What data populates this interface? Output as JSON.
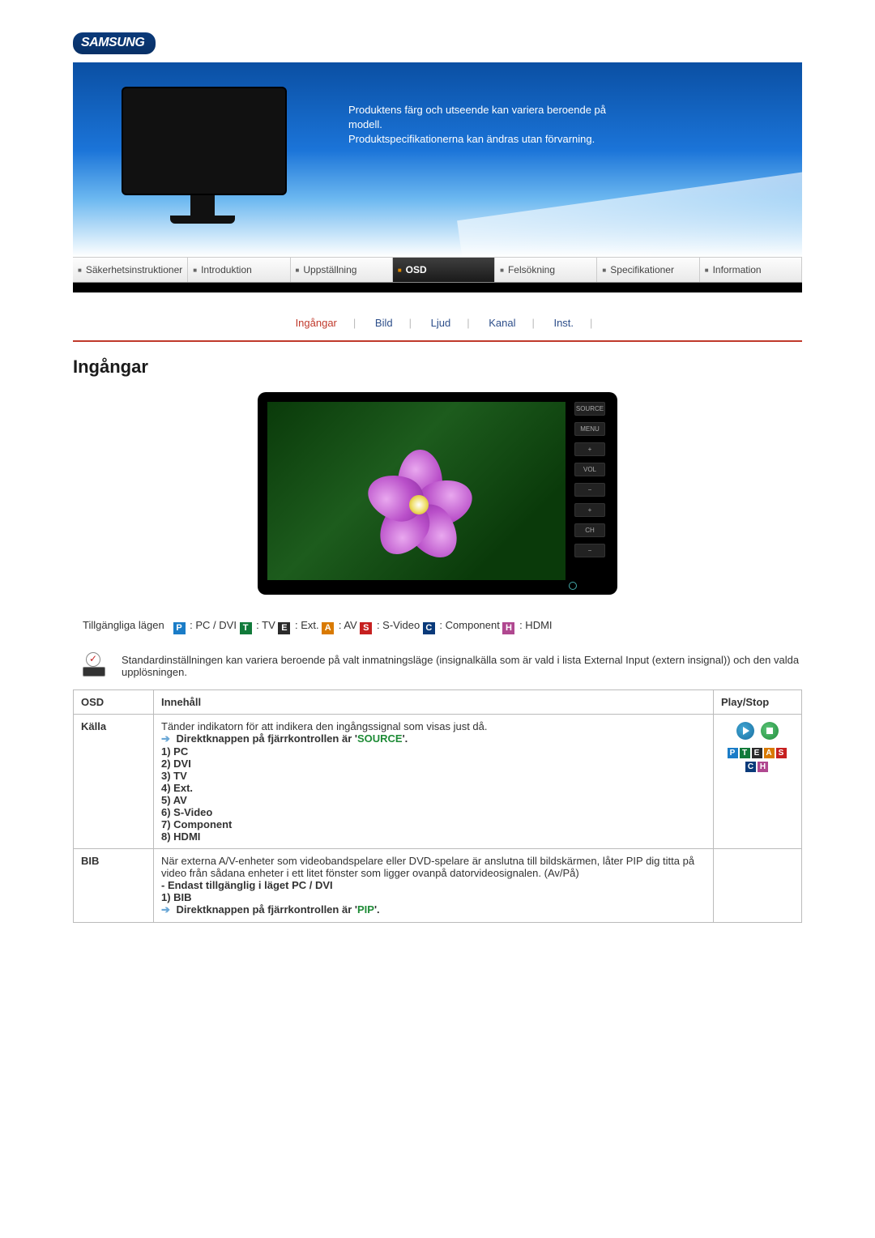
{
  "brand": "SAMSUNG",
  "hero_line1": "Produktens färg och utseende kan variera beroende på modell.",
  "hero_line2": "Produktspecifikationerna kan ändras utan förvarning.",
  "mainnav": {
    "items": [
      "Säkerhetsinstruktioner",
      "Introduktion",
      "Uppställning",
      "OSD",
      "Felsökning",
      "Specifikationer",
      "Information"
    ],
    "active_index": 3
  },
  "subnav": {
    "items": [
      "Ingångar",
      "Bild",
      "Ljud",
      "Kanal",
      "Inst."
    ],
    "current_index": 0
  },
  "section_title": "Ingångar",
  "tv_side_buttons": [
    "SOURCE",
    "MENU",
    "+",
    "VOL",
    "−",
    "+",
    "CH",
    "−"
  ],
  "modes": {
    "label": "Tillgängliga lägen",
    "list": [
      {
        "badge": "P",
        "cls": "b-p",
        "text": ": PC / DVI"
      },
      {
        "badge": "T",
        "cls": "b-t",
        "text": ": TV"
      },
      {
        "badge": "E",
        "cls": "b-e",
        "text": ": Ext."
      },
      {
        "badge": "A",
        "cls": "b-a",
        "text": ": AV"
      },
      {
        "badge": "S",
        "cls": "b-s",
        "text": ": S-Video"
      },
      {
        "badge": "C",
        "cls": "b-c",
        "text": ": Component"
      },
      {
        "badge": "H",
        "cls": "b-h",
        "text": ": HDMI"
      }
    ]
  },
  "note": "Standardinställningen kan variera beroende på valt inmatningsläge (insignalkälla som är vald i lista External Input (extern insignal)) och den valda upplösningen.",
  "table": {
    "headers": {
      "osd": "OSD",
      "content": "Innehåll",
      "play": "Play/Stop"
    },
    "rows": [
      {
        "osd": "Källa",
        "desc": "Tänder indikatorn för att indikera den ingångssignal som visas just då.",
        "direct_pre": "Direktknappen på fjärrkontrollen är '",
        "direct_key": "SOURCE",
        "direct_post": "'.",
        "items": [
          "1) PC",
          "2) DVI",
          "3) TV",
          "4) Ext.",
          "5) AV",
          "6) S-Video",
          "7) Component",
          "8) HDMI"
        ],
        "show_play": true
      },
      {
        "osd": "BIB",
        "desc": "När externa A/V-enheter som videobandspelare eller DVD-spelare är anslutna till bildskärmen, låter PIP dig titta på video från sådana enheter i ett litet fönster som ligger ovanpå datorvideosignalen. (Av/På)",
        "note": "- Endast tillgänglig i läget PC / DVI",
        "items": [
          "1) BIB"
        ],
        "direct_pre": "Direktknappen på fjärrkontrollen är '",
        "direct_key": "PIP",
        "direct_post": "'.",
        "show_play": false
      }
    ]
  }
}
